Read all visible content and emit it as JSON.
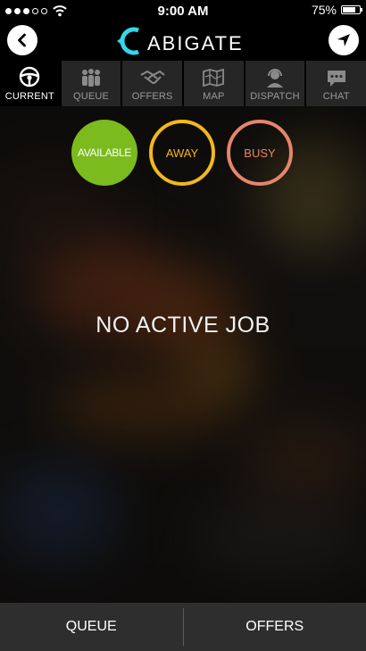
{
  "status_bar": {
    "time": "9:00 AM",
    "battery": "75%",
    "battery_level": 0.75,
    "signal_bars_filled": 3,
    "signal_bars_total": 5
  },
  "header": {
    "logo_text": "ABIGATE",
    "logo_letter": "C",
    "logo_color": "#35d6e8"
  },
  "tabs": [
    {
      "label": "CURRENT",
      "icon": "steering-wheel-icon",
      "active": true
    },
    {
      "label": "QUEUE",
      "icon": "people-icon",
      "active": false
    },
    {
      "label": "OFFERS",
      "icon": "handshake-icon",
      "active": false
    },
    {
      "label": "MAP",
      "icon": "map-icon",
      "active": false
    },
    {
      "label": "DISPATCH",
      "icon": "headset-icon",
      "active": false
    },
    {
      "label": "CHAT",
      "icon": "chat-bubble-icon",
      "active": false
    }
  ],
  "availability": {
    "available": "AVAILABLE",
    "away": "AWAY",
    "busy": "BUSY",
    "colors": {
      "available": "#7bbb1e",
      "away": "#f2b81c",
      "busy": "#e6856c"
    }
  },
  "main": {
    "empty_message": "NO ACTIVE JOB"
  },
  "bottom_bar": {
    "queue": "QUEUE",
    "offers": "OFFERS"
  }
}
